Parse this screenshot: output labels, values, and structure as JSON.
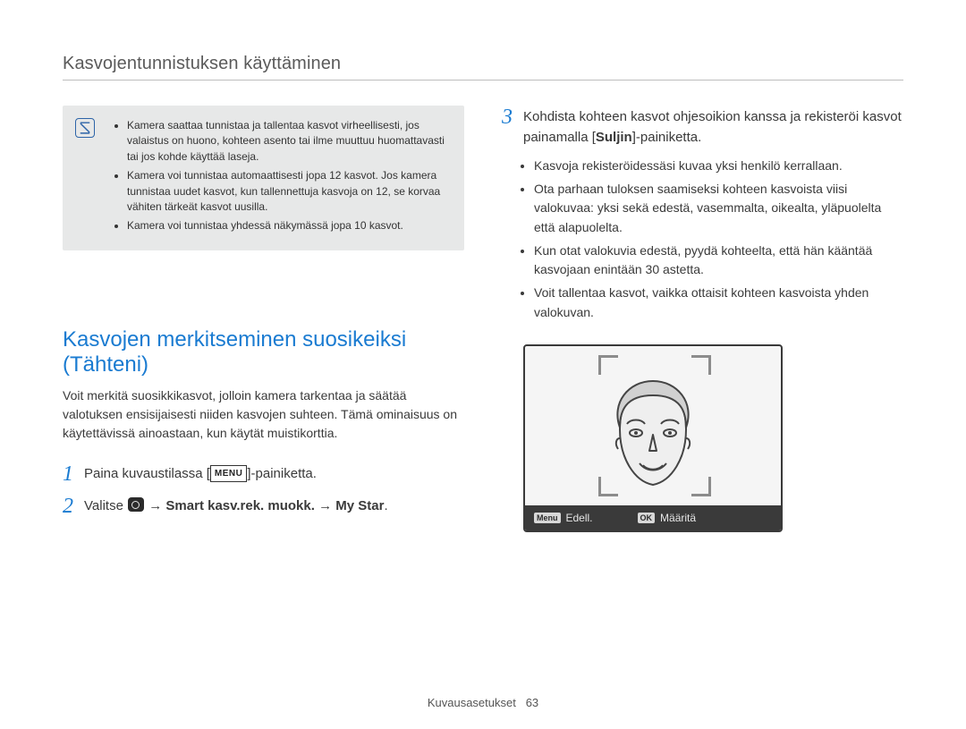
{
  "header": {
    "title": "Kasvojentunnistuksen käyttäminen"
  },
  "note": {
    "items": [
      "Kamera saattaa tunnistaa ja tallentaa kasvot virheellisesti, jos valaistus on huono, kohteen asento tai ilme muuttuu huomattavasti tai jos kohde käyttää laseja.",
      "Kamera voi tunnistaa automaattisesti jopa 12 kasvot. Jos kamera tunnistaa uudet kasvot, kun tallennettuja kasvoja on 12, se korvaa vähiten tärkeät kasvot uusilla.",
      "Kamera voi tunnistaa yhdessä näkymässä jopa 10 kasvot."
    ]
  },
  "section": {
    "title": "Kasvojen merkitseminen suosikeiksi (Tähteni)",
    "intro": "Voit merkitä suosikkikasvot, jolloin kamera tarkentaa ja säätää valotuksen ensisijaisesti niiden kasvojen suhteen. Tämä ominaisuus on käytettävissä ainoastaan, kun käytät muistikorttia."
  },
  "steps": {
    "s1": {
      "num": "1",
      "prefix": "Paina kuvaustilassa [",
      "badge": "MENU",
      "suffix": "]-painiketta."
    },
    "s2": {
      "num": "2",
      "prefix": "Valitse ",
      "arrow1": " → ",
      "bold1": "Smart kasv.rek. muokk.",
      "arrow2": " → ",
      "bold2": "My Star",
      "suffix": "."
    },
    "s3": {
      "num": "3",
      "line_prefix": "Kohdista kohteen kasvot ohjesoikion kanssa ja rekisteröi kasvot painamalla [",
      "bold": "Suljin",
      "line_suffix": "]-painiketta.",
      "bullets": [
        "Kasvoja rekisteröidessäsi kuvaa yksi henkilö kerrallaan.",
        "Ota parhaan tuloksen saamiseksi kohteen kasvoista viisi valokuvaa: yksi sekä edestä, vasemmalta, oikealta, yläpuolelta että alapuolelta.",
        "Kun otat valokuvia edestä, pyydä kohteelta, että hän kääntää kasvojaan enintään 30 astetta.",
        "Voit tallentaa kasvot, vaikka ottaisit kohteen kasvoista yhden valokuvan."
      ]
    }
  },
  "screen": {
    "menu_badge": "Menu",
    "back_label": "Edell.",
    "ok_badge": "OK",
    "set_label": "Määritä"
  },
  "footer": {
    "section": "Kuvausasetukset",
    "page": "63"
  }
}
